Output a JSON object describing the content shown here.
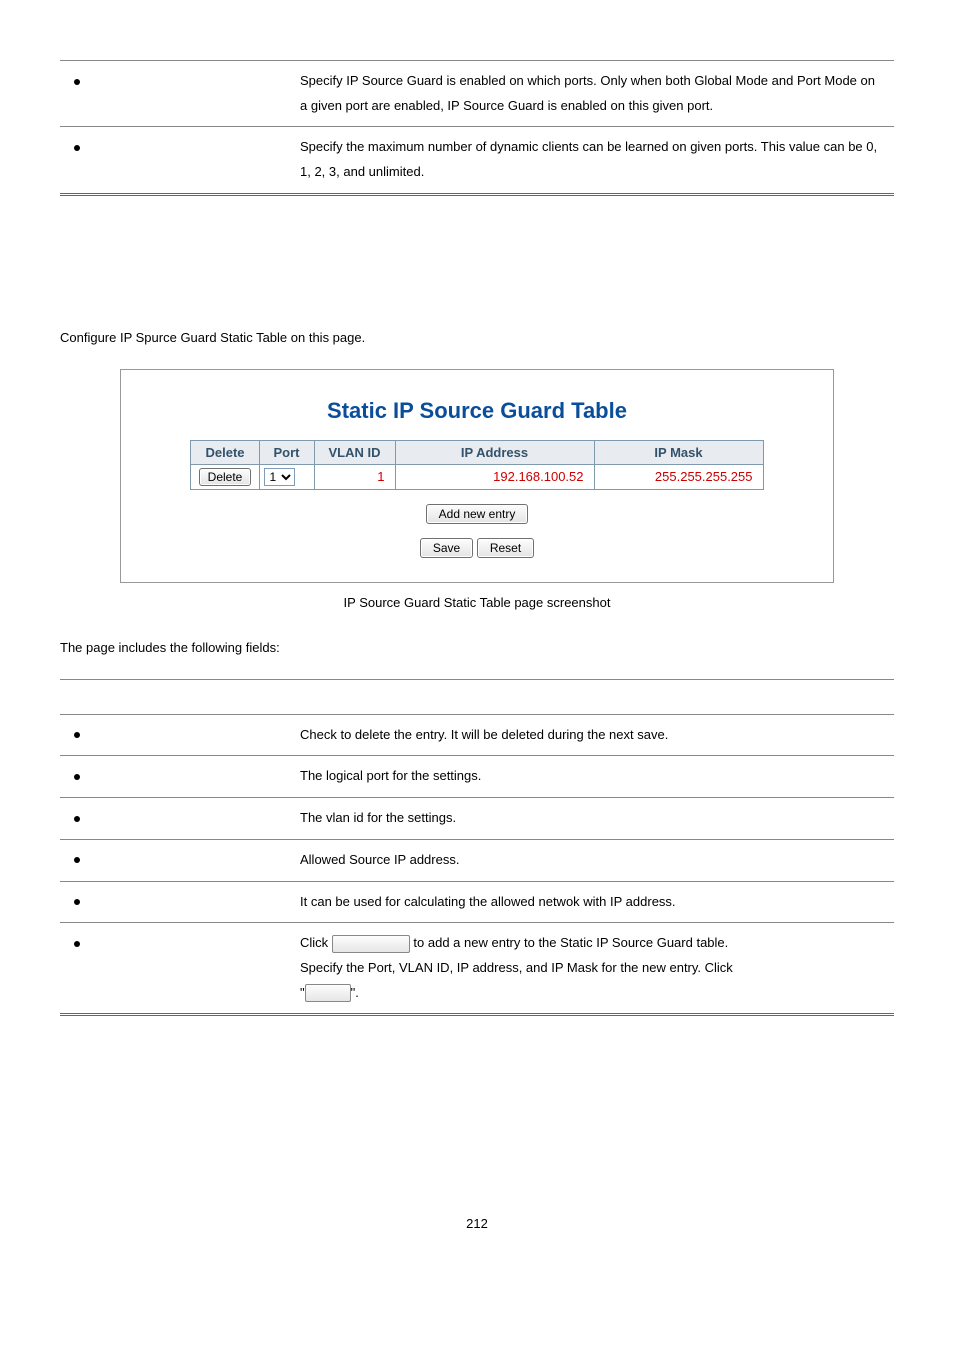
{
  "top_table": {
    "rows": [
      {
        "desc": "Specify IP Source Guard is enabled on which ports. Only when both Global Mode and Port Mode on a given port are enabled, IP Source Guard is enabled on this given port."
      },
      {
        "desc": "Specify the maximum number of dynamic clients can be learned on given ports. This value can be 0, 1, 2, 3, and unlimited."
      }
    ]
  },
  "config_para": "Configure IP Spurce Guard Static Table on this page.",
  "figure": {
    "title": "Static IP Source Guard Table",
    "headers": {
      "delete": "Delete",
      "port": "Port",
      "vlan": "VLAN ID",
      "ip": "IP Address",
      "mask": "IP Mask"
    },
    "row": {
      "delete": "Delete",
      "port": "1",
      "vlan": "1",
      "ip": "192.168.100.52",
      "mask": "255.255.255.255"
    },
    "add_btn": "Add new entry",
    "save_btn": "Save",
    "reset_btn": "Reset"
  },
  "caption": "IP Source Guard Static Table page screenshot",
  "fields_intro": "The page includes the following fields:",
  "fields_table": {
    "rows": [
      {
        "desc": "Check to delete the entry. It will be deleted during the next save."
      },
      {
        "desc": "The logical port for the settings."
      },
      {
        "desc": "The vlan id for the settings."
      },
      {
        "desc": "Allowed Source IP address."
      },
      {
        "desc": "It can be used for calculating the allowed netwok with IP address."
      }
    ],
    "last": {
      "click": "Click",
      "tail": " to add a new entry to the Static IP Source Guard table.",
      "line2a": "Specify the Port, VLAN ID, IP address, and IP Mask for the new entry. Click",
      "line2b": "\"",
      "line2c": "\"."
    }
  },
  "pagenum": "212"
}
